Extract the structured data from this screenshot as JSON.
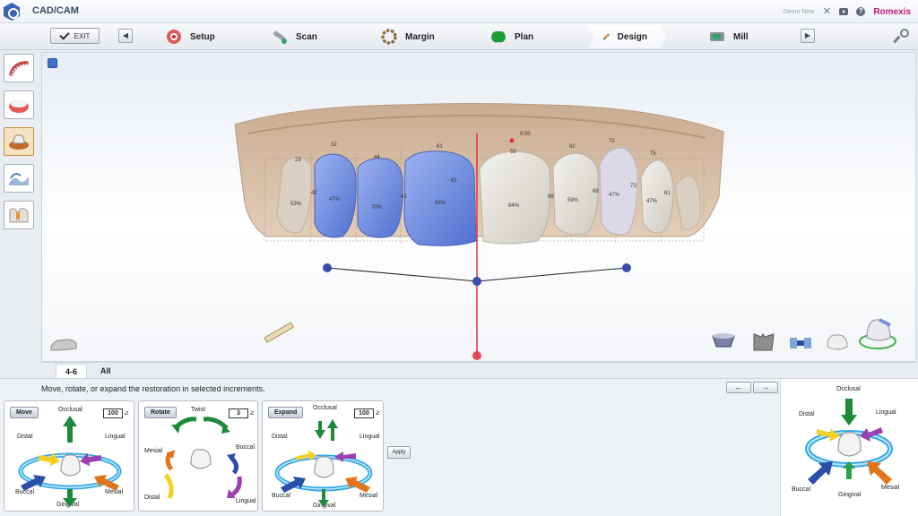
{
  "app": {
    "title": "CAD/CAM",
    "user": "Demo New",
    "brand": "Romexis"
  },
  "workflow": {
    "exit_label": "EXIT",
    "steps": [
      {
        "label": "Setup",
        "icon": "setup-icon"
      },
      {
        "label": "Scan",
        "icon": "scan-icon"
      },
      {
        "label": "Margin",
        "icon": "margin-icon"
      },
      {
        "label": "Plan",
        "icon": "plan-icon"
      },
      {
        "label": "Design",
        "icon": "design-icon",
        "active": true
      },
      {
        "label": "Mill",
        "icon": "mill-icon"
      }
    ]
  },
  "viewport": {
    "teeth_labels": [
      "53%",
      "47%",
      "70%",
      "83%",
      "84%",
      "59%",
      "47%",
      "47%"
    ],
    "upper_labels": [
      "29",
      "32",
      "44",
      "61",
      "59",
      "62",
      "72",
      "75"
    ],
    "side_labels": [
      "42",
      "41",
      "61",
      "69",
      "68",
      "73",
      "61"
    ],
    "top_marker": "0.00"
  },
  "tabs": [
    {
      "label": "4-6",
      "active": true
    },
    {
      "label": "All"
    }
  ],
  "panel": {
    "instruction": "Move, rotate, or expand the restoration in selected increments.",
    "undo": "←",
    "redo": "→",
    "move": {
      "title": "Move",
      "value": "100",
      "labels": {
        "top": "Occlusal",
        "left": "Distal",
        "right": "Lingual",
        "bl": "Buccal",
        "br": "Mesial",
        "bottom": "Gingival"
      }
    },
    "rotate": {
      "title": "Rotate",
      "value": "3",
      "labels": {
        "top": "Twist",
        "left": "Mesial",
        "right": "Buccal",
        "bl": "Distal",
        "br": "Lingual"
      }
    },
    "expand": {
      "title": "Expand",
      "value": "100",
      "labels": {
        "top": "Occlusal",
        "left": "Distal",
        "right": "Lingual",
        "bl": "Buccal",
        "br": "Mesial",
        "bottom": "Gingival"
      }
    },
    "apply": "Apply",
    "arrow_glyph": "≥"
  },
  "orientation": {
    "labels": {
      "top": "Occlusal",
      "left": "Distal",
      "right": "Lingual",
      "bl": "Buccal",
      "br": "Mesial",
      "bottom": "Gingival"
    }
  },
  "colors": {
    "accent_blue": "#6f8fe0",
    "arrow_green": "#1d8a3a",
    "arrow_yellow": "#f2d024",
    "arrow_purple": "#9b3fb3",
    "arrow_blue": "#2b4fa8",
    "arrow_orange": "#e2751c",
    "ring": "#35a9e6",
    "midline": "#e2313f",
    "brand": "#c41e78"
  }
}
